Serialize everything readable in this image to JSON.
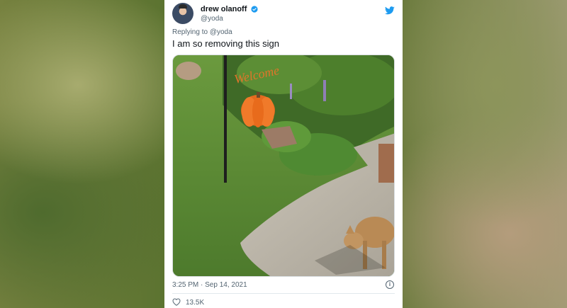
{
  "tweet": {
    "author_name": "drew olanoff",
    "author_handle": "@yoda",
    "replying_prefix": "Replying to",
    "replying_to": "@yoda",
    "text": "I am so removing this sign",
    "timestamp": "3:25 PM · Sep 14, 2021",
    "likes": "13.5K",
    "photo_sign_text": "Welcome"
  },
  "icons": {
    "verified": "verified-badge-icon",
    "bird": "twitter-bird-icon",
    "info": "info-icon",
    "like": "heart-icon"
  },
  "colors": {
    "twitter_blue": "#1d9bf0",
    "text_primary": "#0f1419",
    "text_secondary": "#536471"
  }
}
